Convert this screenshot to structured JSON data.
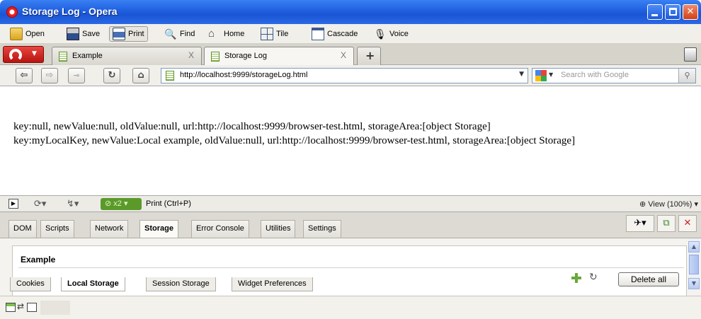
{
  "window": {
    "title": "Storage Log - Opera"
  },
  "toolbar": {
    "open": "Open",
    "save": "Save",
    "print": "Print",
    "find": "Find",
    "home": "Home",
    "tile": "Tile",
    "cascade": "Cascade",
    "voice": "Voice"
  },
  "tabs": [
    {
      "label": "Example",
      "close": "X"
    },
    {
      "label": "Storage Log",
      "close": "X"
    }
  ],
  "address": {
    "url": "http://localhost:9999/storageLog.html",
    "search_placeholder": "Search with Google"
  },
  "content": {
    "lines": [
      "key:null, newValue:null, oldValue:null, url:http://localhost:9999/browser-test.html, storageArea:[object Storage]",
      "key:myLocalKey, newValue:Local example, oldValue:null, url:http://localhost:9999/browser-test.html, storageArea:[object Storage]"
    ]
  },
  "status": {
    "turbo": "x2",
    "text": "Print (Ctrl+P)",
    "zoom": "View (100%)"
  },
  "devtools": {
    "tabs": [
      "DOM",
      "Scripts",
      "Network",
      "Storage",
      "Error Console",
      "Utilities",
      "Settings"
    ],
    "active_tab": "Storage",
    "panel_title": "Example",
    "delete_all": "Delete all",
    "subtabs": [
      "Cookies",
      "Local Storage",
      "Session Storage",
      "Widget Preferences"
    ],
    "active_subtab": "Local Storage"
  },
  "colors": {
    "titlebar": "#1f5fe0",
    "turbo": "#5b9a2a",
    "opera_red": "#d8261f"
  }
}
